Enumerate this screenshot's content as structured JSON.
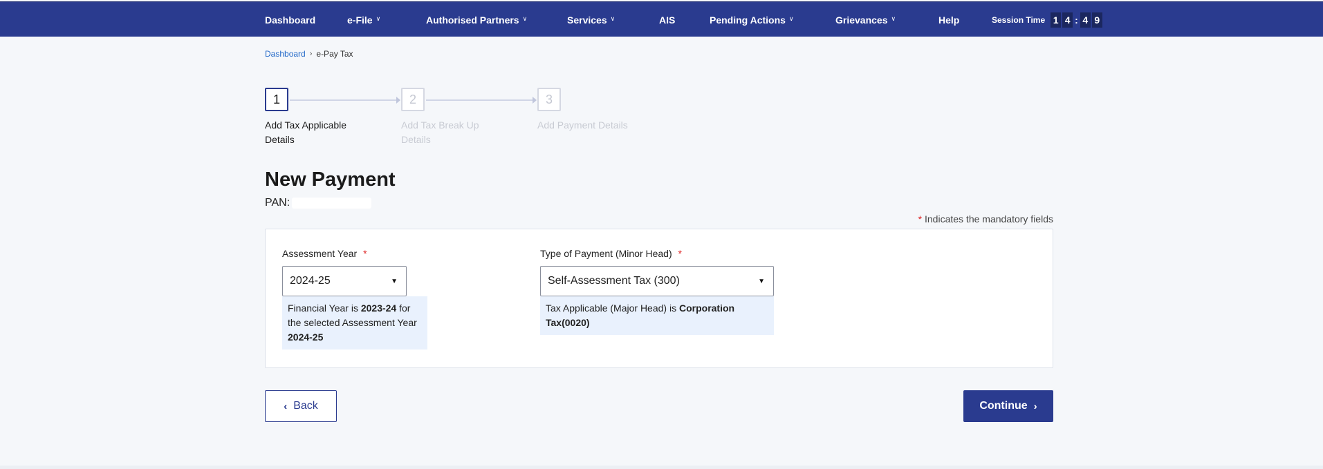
{
  "nav": {
    "items": [
      {
        "label": "Dashboard",
        "dropdown": false
      },
      {
        "label": "e-File",
        "dropdown": true
      },
      {
        "label": "Authorised Partners",
        "dropdown": true
      },
      {
        "label": "Services",
        "dropdown": true
      },
      {
        "label": "AIS",
        "dropdown": false
      },
      {
        "label": "Pending Actions",
        "dropdown": true
      },
      {
        "label": "Grievances",
        "dropdown": true
      },
      {
        "label": "Help",
        "dropdown": false
      }
    ],
    "session_label": "Session Time",
    "session_digits": [
      "1",
      "4",
      "4",
      "9"
    ],
    "session_separator": ":"
  },
  "breadcrumb": {
    "home": "Dashboard",
    "separator": "›",
    "current": "e-Pay Tax"
  },
  "stepper": [
    {
      "number": "1",
      "label": "Add Tax Applicable Details",
      "active": true
    },
    {
      "number": "2",
      "label": "Add Tax Break Up Details",
      "active": false
    },
    {
      "number": "3",
      "label": "Add Payment Details",
      "active": false
    }
  ],
  "page": {
    "title": "New Payment",
    "pan_label": "PAN:",
    "mandatory_star": "*",
    "mandatory_note": "Indicates the mandatory fields"
  },
  "form": {
    "assessment_year": {
      "label": "Assessment Year",
      "required_mark": "*",
      "value": "2024-25",
      "hint_part1": "Financial Year is ",
      "hint_fy": "2023-24",
      "hint_part2": " for the selected Assessment Year ",
      "hint_ay": "2024-25"
    },
    "payment_type": {
      "label": "Type of Payment (Minor Head)",
      "required_mark": "*",
      "value": "Self-Assessment Tax (300)",
      "hint_part1": "Tax Applicable (Major Head) is ",
      "hint_major": "Corporation Tax(0020)"
    }
  },
  "actions": {
    "back_label": "Back",
    "continue_label": "Continue"
  },
  "icons": {
    "dropdown": "chevron-down-icon",
    "back": "chevron-left-icon",
    "continue": "chevron-right-icon"
  },
  "colors": {
    "brand": "#2a3b8f",
    "link": "#2168c8",
    "required": "#dd2222",
    "hint_bg": "#e9f1fd"
  }
}
